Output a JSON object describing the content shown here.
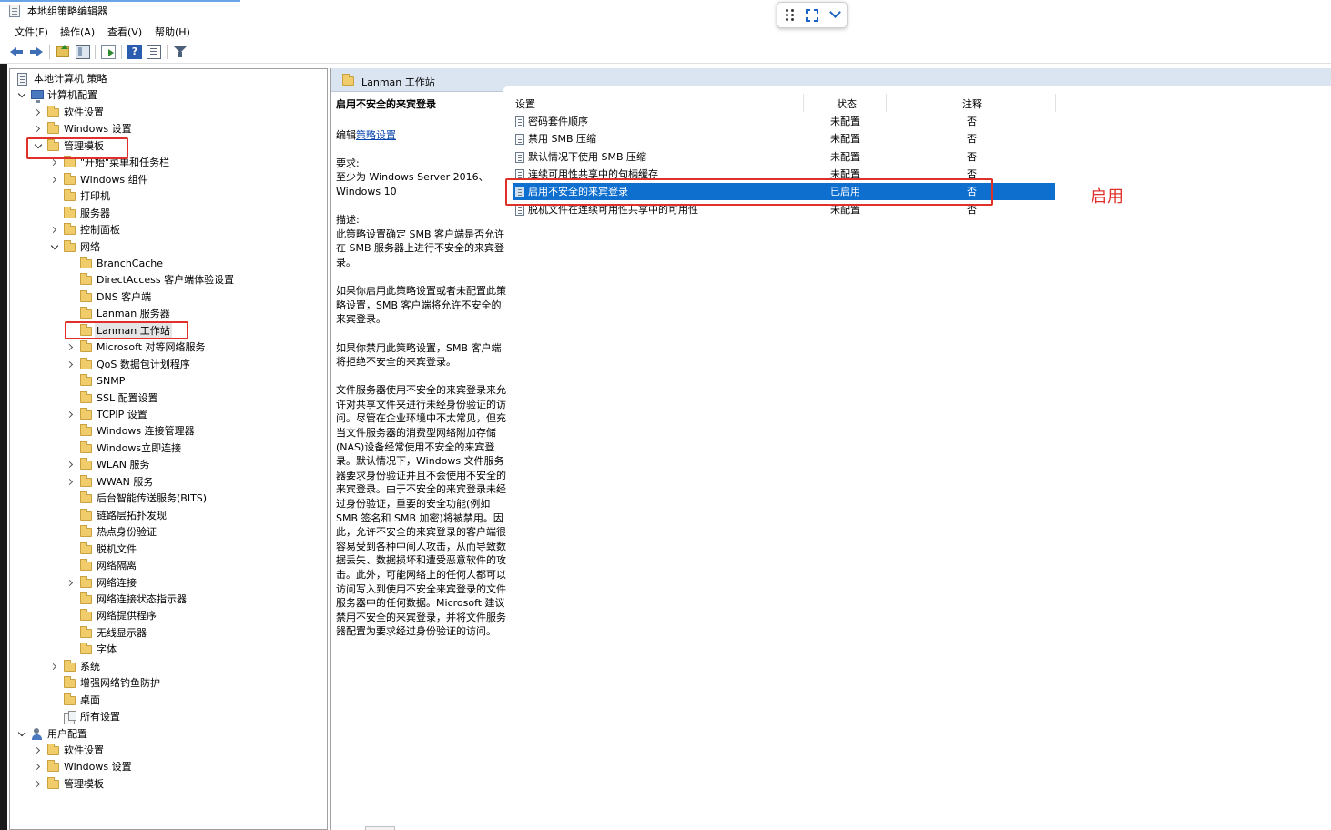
{
  "window": {
    "title": "本地组策略编辑器"
  },
  "menu": [
    {
      "label": "文件(F)"
    },
    {
      "label": "操作(A)"
    },
    {
      "label": "查看(V)"
    },
    {
      "label": "帮助(H)"
    }
  ],
  "toolbar": {
    "buttons": [
      {
        "icon": "back-arrow-icon"
      },
      {
        "icon": "forward-arrow-icon"
      },
      {
        "icon": "up-folder-icon"
      },
      {
        "icon": "show-hide-console-tree-icon"
      },
      {
        "icon": "export-list-icon"
      },
      {
        "icon": "help-icon",
        "glyph": "?"
      },
      {
        "icon": "properties-icon"
      },
      {
        "icon": "filter-icon"
      }
    ]
  },
  "tree": [
    {
      "label": "本地计算机 策略",
      "icon": "policy-root",
      "depth": 0,
      "expander": "none"
    },
    {
      "label": "计算机配置",
      "icon": "computer",
      "depth": 0,
      "expander": "open"
    },
    {
      "label": "软件设置",
      "icon": "folder",
      "depth": 1,
      "expander": "closed"
    },
    {
      "label": "Windows 设置",
      "icon": "folder",
      "depth": 1,
      "expander": "closed"
    },
    {
      "label": "管理模板",
      "icon": "folder",
      "depth": 1,
      "expander": "open",
      "highlighted": true
    },
    {
      "label": "\"开始\"菜单和任务栏",
      "icon": "folder",
      "depth": 2,
      "expander": "closed"
    },
    {
      "label": "Windows 组件",
      "icon": "folder",
      "depth": 2,
      "expander": "closed"
    },
    {
      "label": "打印机",
      "icon": "folder",
      "depth": 2,
      "expander": "none"
    },
    {
      "label": "服务器",
      "icon": "folder",
      "depth": 2,
      "expander": "none"
    },
    {
      "label": "控制面板",
      "icon": "folder",
      "depth": 2,
      "expander": "closed"
    },
    {
      "label": "网络",
      "icon": "folder",
      "depth": 2,
      "expander": "open"
    },
    {
      "label": "BranchCache",
      "icon": "folder",
      "depth": 3,
      "expander": "none"
    },
    {
      "label": "DirectAccess 客户端体验设置",
      "icon": "folder",
      "depth": 3,
      "expander": "none"
    },
    {
      "label": "DNS 客户端",
      "icon": "folder",
      "depth": 3,
      "expander": "none"
    },
    {
      "label": "Lanman 服务器",
      "icon": "folder",
      "depth": 3,
      "expander": "none"
    },
    {
      "label": "Lanman 工作站",
      "icon": "folder",
      "depth": 3,
      "expander": "none",
      "selected": true,
      "highlighted": true
    },
    {
      "label": "Microsoft 对等网络服务",
      "icon": "folder",
      "depth": 3,
      "expander": "closed"
    },
    {
      "label": "QoS 数据包计划程序",
      "icon": "folder",
      "depth": 3,
      "expander": "closed"
    },
    {
      "label": "SNMP",
      "icon": "folder",
      "depth": 3,
      "expander": "none"
    },
    {
      "label": "SSL 配置设置",
      "icon": "folder",
      "depth": 3,
      "expander": "none"
    },
    {
      "label": "TCPIP 设置",
      "icon": "folder",
      "depth": 3,
      "expander": "closed"
    },
    {
      "label": "Windows 连接管理器",
      "icon": "folder",
      "depth": 3,
      "expander": "none"
    },
    {
      "label": "Windows立即连接",
      "icon": "folder",
      "depth": 3,
      "expander": "none"
    },
    {
      "label": "WLAN 服务",
      "icon": "folder",
      "depth": 3,
      "expander": "closed"
    },
    {
      "label": "WWAN 服务",
      "icon": "folder",
      "depth": 3,
      "expander": "closed"
    },
    {
      "label": "后台智能传送服务(BITS)",
      "icon": "folder",
      "depth": 3,
      "expander": "none"
    },
    {
      "label": "链路层拓扑发现",
      "icon": "folder",
      "depth": 3,
      "expander": "none"
    },
    {
      "label": "热点身份验证",
      "icon": "folder",
      "depth": 3,
      "expander": "none"
    },
    {
      "label": "脱机文件",
      "icon": "folder",
      "depth": 3,
      "expander": "none"
    },
    {
      "label": "网络隔离",
      "icon": "folder",
      "depth": 3,
      "expander": "none"
    },
    {
      "label": "网络连接",
      "icon": "folder",
      "depth": 3,
      "expander": "closed"
    },
    {
      "label": "网络连接状态指示器",
      "icon": "folder",
      "depth": 3,
      "expander": "none"
    },
    {
      "label": "网络提供程序",
      "icon": "folder",
      "depth": 3,
      "expander": "none"
    },
    {
      "label": "无线显示器",
      "icon": "folder",
      "depth": 3,
      "expander": "none"
    },
    {
      "label": "字体",
      "icon": "folder",
      "depth": 3,
      "expander": "none"
    },
    {
      "label": "系统",
      "icon": "folder",
      "depth": 2,
      "expander": "closed"
    },
    {
      "label": "增强网络钓鱼防护",
      "icon": "folder",
      "depth": 2,
      "expander": "none"
    },
    {
      "label": "桌面",
      "icon": "folder",
      "depth": 2,
      "expander": "none"
    },
    {
      "label": "所有设置",
      "icon": "all-settings",
      "depth": 2,
      "expander": "none"
    },
    {
      "label": "用户配置",
      "icon": "user",
      "depth": 0,
      "expander": "open"
    },
    {
      "label": "软件设置",
      "icon": "folder",
      "depth": 1,
      "expander": "closed"
    },
    {
      "label": "Windows 设置",
      "icon": "folder",
      "depth": 1,
      "expander": "closed"
    },
    {
      "label": "管理模板",
      "icon": "folder",
      "depth": 1,
      "expander": "closed"
    }
  ],
  "right_header": {
    "title": "Lanman 工作站"
  },
  "description": {
    "title": "启用不安全的来宾登录",
    "edit_prefix": "编辑",
    "edit_link": "策略设置",
    "requirements_label": "要求:",
    "requirements_text": "至少为 Windows Server 2016、Windows 10",
    "description_label": "描述:",
    "paragraphs": [
      "此策略设置确定 SMB 客户端是否允许在 SMB 服务器上进行不安全的来宾登录。",
      "如果你启用此策略设置或者未配置此策略设置，SMB 客户端将允许不安全的来宾登录。",
      "如果你禁用此策略设置，SMB 客户端将拒绝不安全的来宾登录。",
      "文件服务器使用不安全的来宾登录来允许对共享文件夹进行未经身份验证的访问。尽管在企业环境中不太常见，但充当文件服务器的消费型网络附加存储(NAS)设备经常使用不安全的来宾登录。默认情况下，Windows 文件服务器要求身份验证并且不会使用不安全的来宾登录。由于不安全的来宾登录未经过身份验证，重要的安全功能(例如 SMB 签名和 SMB 加密)将被禁用。因此，允许不安全的来宾登录的客户端很容易受到各种中间人攻击，从而导致数据丢失、数据损坏和遭受恶意软件的攻击。此外，可能网络上的任何人都可以访问写入到使用不安全来宾登录的文件服务器中的任何数据。Microsoft 建议禁用不安全的来宾登录，并将文件服务器配置为要求经过身份验证的访问。"
    ]
  },
  "list": {
    "columns": [
      "设置",
      "状态",
      "注释"
    ],
    "rows": [
      {
        "name": "密码套件顺序",
        "state": "未配置",
        "note": "否"
      },
      {
        "name": "禁用 SMB 压缩",
        "state": "未配置",
        "note": "否"
      },
      {
        "name": "默认情况下使用 SMB 压缩",
        "state": "未配置",
        "note": "否"
      },
      {
        "name": "连续可用性共享中的句柄缓存",
        "state": "未配置",
        "note": "否"
      },
      {
        "name": "启用不安全的来宾登录",
        "state": "已启用",
        "note": "否",
        "selected": true
      },
      {
        "name": "脱机文件在连续可用性共享中的可用性",
        "state": "未配置",
        "note": "否"
      }
    ]
  },
  "annotation": {
    "text": "启用"
  },
  "colors": {
    "selection": "#0f6fcf",
    "highlight_box": "#e0302a",
    "header_band": "#dbe5f1"
  }
}
